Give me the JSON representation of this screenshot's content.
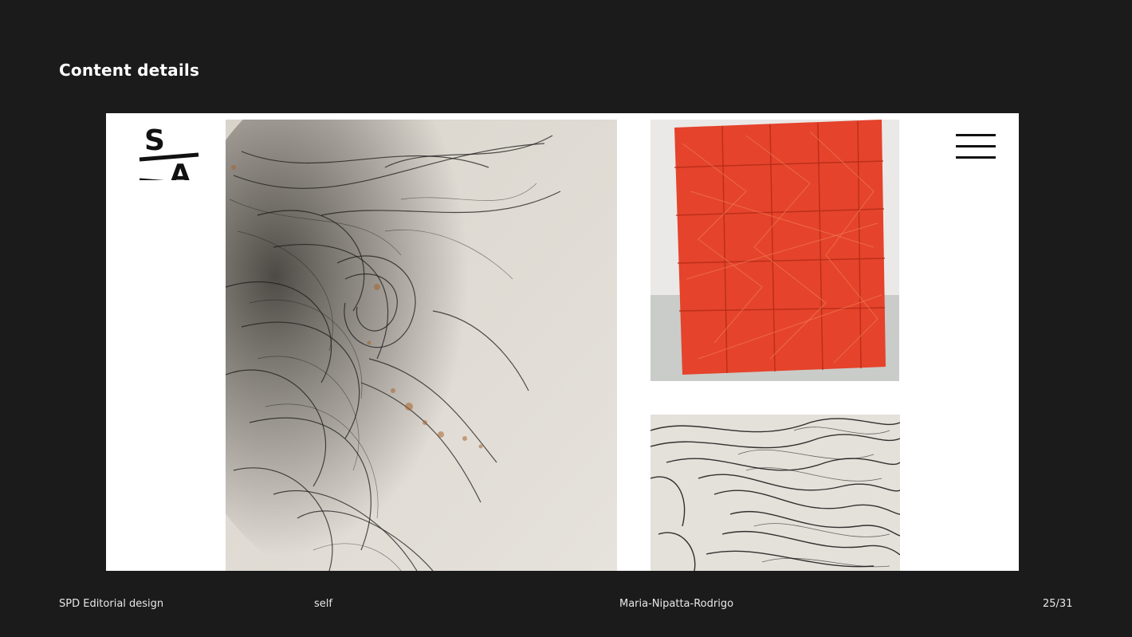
{
  "slide": {
    "title": "Content details"
  },
  "mockup": {
    "logo": {
      "letter_top": "S",
      "letter_bottom": "A"
    },
    "menu_icon": "hamburger-menu-icon",
    "images": [
      {
        "subject": "abstract black ink brushwork drawing with rust stains"
      },
      {
        "subject": "red sculptural wire mesh cube in white room"
      },
      {
        "subject": "dense black ink line drawing detail"
      }
    ]
  },
  "footer": {
    "course": "SPD Editorial design",
    "type": "self",
    "author": "Maria-Nipatta-Rodrigo",
    "page": "25/31"
  },
  "colors": {
    "background": "#1b1b1b",
    "mockup_bg": "#ffffff",
    "accent_red": "#e5432b",
    "ink": "#111111"
  }
}
